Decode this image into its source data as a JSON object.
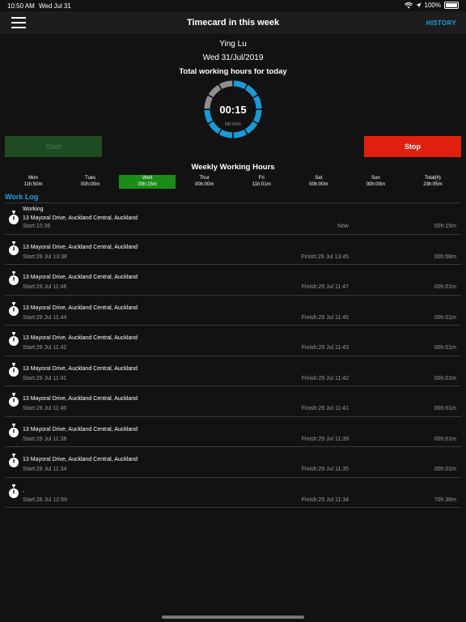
{
  "status": {
    "time": "10:50 AM",
    "date": "Wed Jul 31",
    "battery": "100%"
  },
  "nav": {
    "title": "Timecard in this week",
    "history": "HISTORY"
  },
  "user": {
    "name": "Ying Lu",
    "date": "Wed 31/Jul/2019"
  },
  "today": {
    "title": "Total working hours for today",
    "time": "00:15",
    "unit": "hh:mm"
  },
  "buttons": {
    "start": "Start",
    "stop": "Stop"
  },
  "weekly": {
    "title": "Weekly Working Hours",
    "days": [
      {
        "name": "Mon",
        "hours": "11h:50m"
      },
      {
        "name": "Tues",
        "hours": "00h:00m"
      },
      {
        "name": "Wed",
        "hours": "00h:15m"
      },
      {
        "name": "Thur",
        "hours": "00h:00m"
      },
      {
        "name": "Fri",
        "hours": "11h:01m"
      },
      {
        "name": "Sat",
        "hours": "00h:00m"
      },
      {
        "name": "Sun",
        "hours": "00h:00m"
      },
      {
        "name": "Total(h)",
        "hours": "23h:05m"
      }
    ]
  },
  "worklog": {
    "title": "Work Log",
    "entries": [
      {
        "status": "Working",
        "address": "13 Mayoral Drive, Auckland Central, Auckland",
        "start": "Start:10:36",
        "finish": "Now",
        "duration": "00h:15m"
      },
      {
        "status": "",
        "address": "13 Mayoral Drive, Auckland Central, Auckland",
        "start": "Start:29 Jul 13:38",
        "finish": "Finish:29 Jul 13:45",
        "duration": "00h:08m"
      },
      {
        "status": "",
        "address": "13 Mayoral Drive, Auckland Central, Auckland",
        "start": "Start:29 Jul 11:46",
        "finish": "Finish:29 Jul 11:47",
        "duration": "00h:01m"
      },
      {
        "status": "",
        "address": "13 Mayoral Drive, Auckland Central, Auckland",
        "start": "Start:29 Jul 11:44",
        "finish": "Finish:29 Jul 11:45",
        "duration": "00h:01m"
      },
      {
        "status": "",
        "address": "13 Mayoral Drive, Auckland Central, Auckland",
        "start": "Start:29 Jul 11:42",
        "finish": "Finish:29 Jul 11:43",
        "duration": "00h:01m"
      },
      {
        "status": "",
        "address": "13 Mayoral Drive, Auckland Central, Auckland",
        "start": "Start:29 Jul 11:41",
        "finish": "Finish:29 Jul 11:42",
        "duration": "00h:01m"
      },
      {
        "status": "",
        "address": "13 Mayoral Drive, Auckland Central, Auckland",
        "start": "Start:29 Jul 11:40",
        "finish": "Finish:29 Jul 11:41",
        "duration": "00h:01m"
      },
      {
        "status": "",
        "address": "13 Mayoral Drive, Auckland Central, Auckland",
        "start": "Start:29 Jul 11:38",
        "finish": "Finish:29 Jul 11:39",
        "duration": "00h:01m"
      },
      {
        "status": "",
        "address": "13 Mayoral Drive, Auckland Central, Auckland",
        "start": "Start:29 Jul 11:34",
        "finish": "Finish:29 Jul 11:35",
        "duration": "00h:01m"
      },
      {
        "status": "",
        "address": ",",
        "start": "Start:26 Jul 12:59",
        "finish": "Finish:29 Jul 11:34",
        "duration": "70h:36m"
      }
    ]
  },
  "colors": {
    "accent": "#1da1e0",
    "stop": "#e0200f",
    "start": "#1f4b20",
    "active_day": "#1b8c17",
    "ring_on": "#1a9ad6",
    "ring_off": "#8e8e8e"
  },
  "icons": {
    "menu": "hamburger-icon",
    "timer": "stopwatch-icon",
    "wifi": "wifi-icon",
    "location": "location-arrow-icon",
    "battery": "battery-icon"
  }
}
